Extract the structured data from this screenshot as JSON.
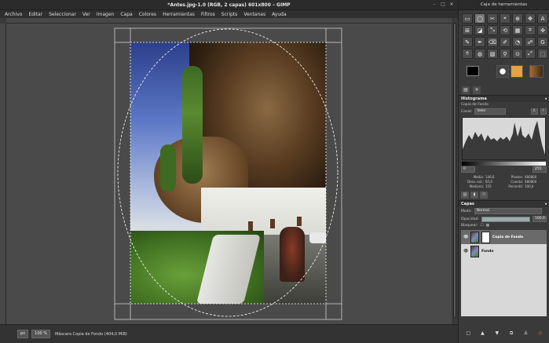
{
  "window": {
    "title": "*Antes.jpg-1.0 (RGB, 2 capas) 601x800 – GIMP"
  },
  "menu": [
    "Archivo",
    "Editar",
    "Seleccionar",
    "Ver",
    "Imagen",
    "Capa",
    "Colores",
    "Herramientas",
    "Filtros",
    "Scripts",
    "Ventanas",
    "Ayuda"
  ],
  "status": {
    "unit": "px",
    "zoom": "100 %",
    "message": "Máscara Copia de Fondo (404,0 MiB)"
  },
  "toolbox": {
    "title": "Caja de herramientas",
    "tools": [
      "▭",
      "◯",
      "✂",
      "⌖",
      "⊕",
      "✥",
      "A",
      "⊞",
      "◪",
      "⤡",
      "⟲",
      "▦",
      "⌗",
      "✜",
      "✎",
      "✒",
      "⌫",
      "✐",
      "◔",
      "☍",
      "G",
      "⌾",
      "◍",
      "▧",
      "⚲",
      "⊙",
      "⤢",
      "⬚"
    ],
    "active_tool_index": 1
  },
  "histogram": {
    "title": "Histograma",
    "layer": "Copia de Fondo",
    "channel_label": "Canal:",
    "channel": "Valor",
    "range_min": "0",
    "range_max": "255",
    "stats": [
      {
        "label": "Media:",
        "value": "146,6",
        "label2": "Píxeles:",
        "value2": "480800"
      },
      {
        "label": "Desv. est.:",
        "value": "65,6",
        "label2": "Cuenta:",
        "value2": "480800"
      },
      {
        "label": "Mediana:",
        "value": "155",
        "label2": "Percentil:",
        "value2": "100,0"
      }
    ]
  },
  "layers": {
    "title": "Capas",
    "mode_label": "Modo:",
    "mode": "Normal",
    "opacity_label": "Opacidad:",
    "opacity": "100,0",
    "opacity_fraction": 1.0,
    "lock_label": "Bloquear:",
    "items": [
      {
        "name": "Copia de Fondo",
        "selected": true
      },
      {
        "name": "Fondo",
        "selected": false
      }
    ]
  }
}
